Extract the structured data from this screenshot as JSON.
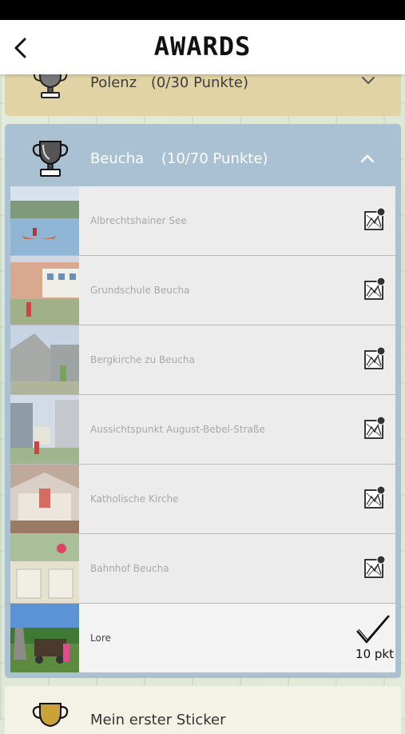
{
  "header": {
    "title": "AWARDS",
    "back_icon": "chevron-left-icon"
  },
  "groups": [
    {
      "id": "polenz",
      "name": "Polenz",
      "points": "(0/30 Punkte)",
      "expanded": false,
      "color": "#e1d3a4"
    },
    {
      "id": "beucha",
      "name": "Beucha",
      "points": "(10/70 Punkte)",
      "expanded": true,
      "color": "#a9c1d2"
    },
    {
      "id": "sticker",
      "name": "Mein erster Sticker",
      "points": "",
      "expanded": false,
      "color": "#f4f1e7"
    }
  ],
  "beucha_items": [
    {
      "label": "Albrechtshainer See",
      "status": "map-marker-icon"
    },
    {
      "label": "Grundschule Beucha",
      "status": "map-marker-icon"
    },
    {
      "label": "Bergkirche zu Beucha",
      "status": "map-marker-icon"
    },
    {
      "label": "Aussichtspunkt August-Bebel-Straße",
      "status": "map-marker-icon"
    },
    {
      "label": "Katholische Kirche",
      "status": "map-marker-icon"
    },
    {
      "label": "Bahnhof Beucha",
      "status": "map-marker-icon"
    },
    {
      "label": "Lore",
      "status": "checkmark-icon",
      "points": "10 pkt"
    }
  ]
}
